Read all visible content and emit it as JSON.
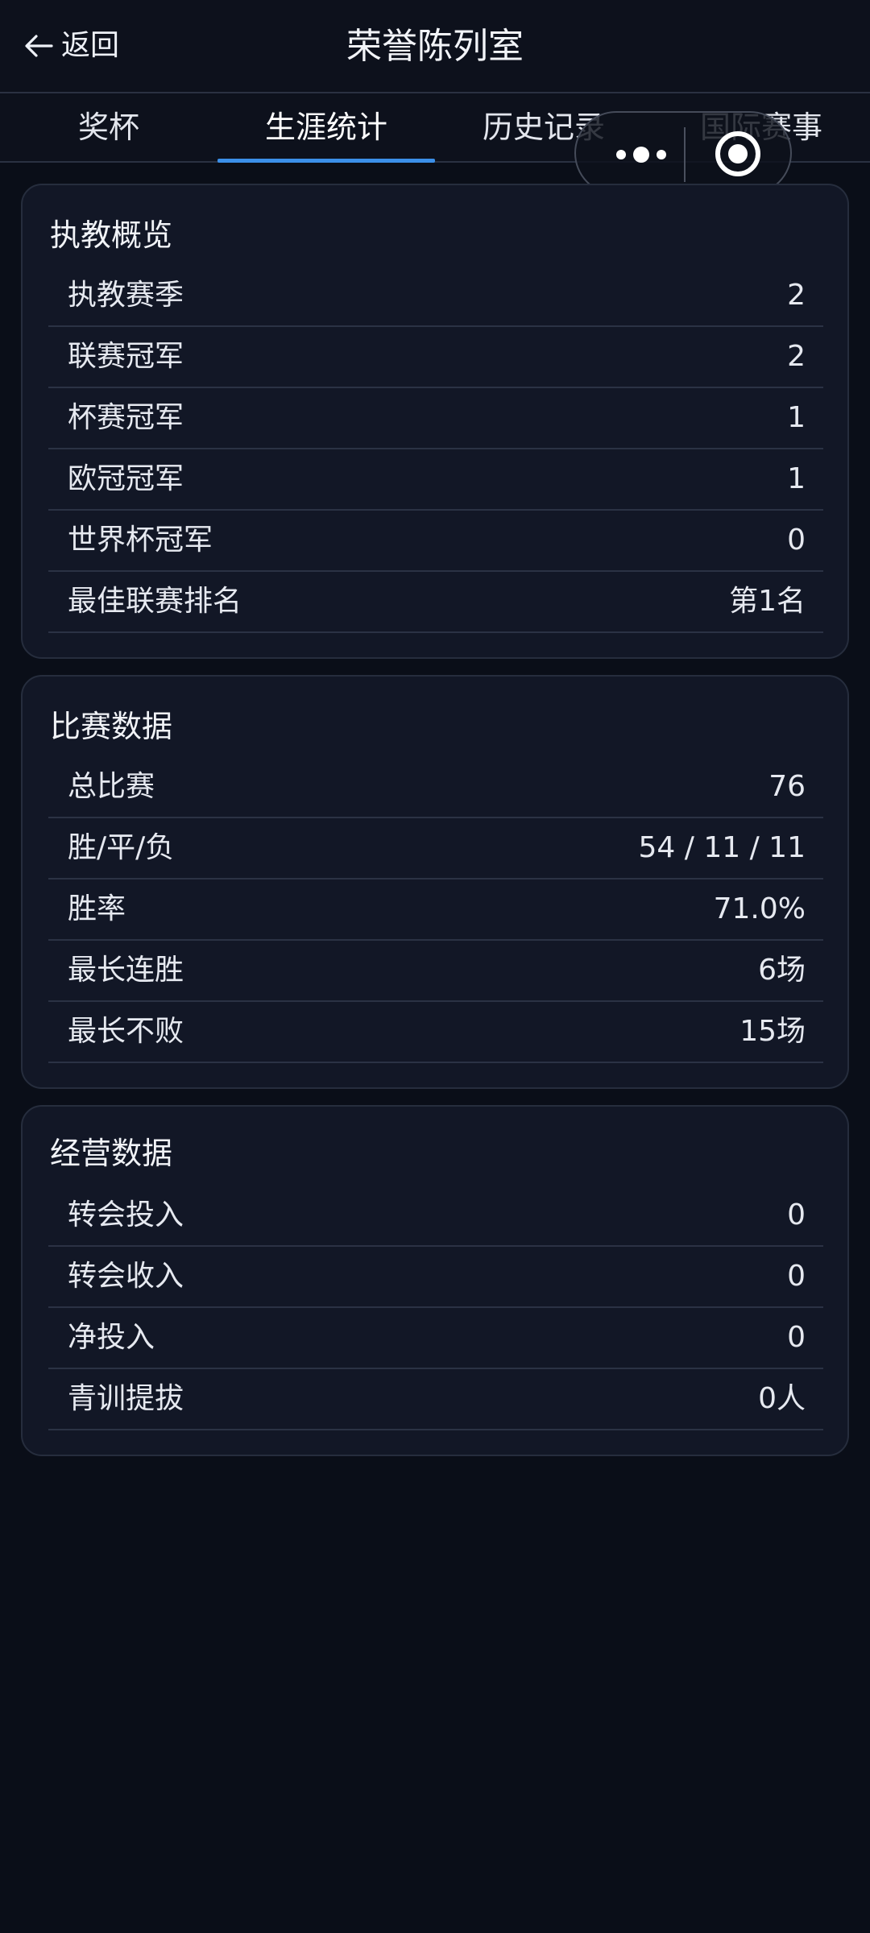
{
  "header": {
    "back_label": "返回",
    "title": "荣誉陈列室"
  },
  "tabs": [
    {
      "label": "奖杯",
      "active": false
    },
    {
      "label": "生涯统计",
      "active": true
    },
    {
      "label": "历史记录",
      "active": false
    },
    {
      "label": "国际赛事",
      "active": false
    }
  ],
  "capsule": {
    "more_icon": "more-dots-icon",
    "close_icon": "target-close-icon"
  },
  "sections": [
    {
      "title": "执教概览",
      "rows": [
        {
          "label": "执教赛季",
          "value": "2"
        },
        {
          "label": "联赛冠军",
          "value": "2"
        },
        {
          "label": "杯赛冠军",
          "value": "1"
        },
        {
          "label": "欧冠冠军",
          "value": "1"
        },
        {
          "label": "世界杯冠军",
          "value": "0"
        },
        {
          "label": "最佳联赛排名",
          "value": "第1名"
        }
      ]
    },
    {
      "title": "比赛数据",
      "rows": [
        {
          "label": "总比赛",
          "value": "76"
        },
        {
          "label": "胜/平/负",
          "value": "54 / 11 / 11"
        },
        {
          "label": "胜率",
          "value": "71.0%"
        },
        {
          "label": "最长连胜",
          "value": "6场"
        },
        {
          "label": "最长不败",
          "value": "15场"
        }
      ]
    },
    {
      "title": "经营数据",
      "rows": [
        {
          "label": "转会投入",
          "value": "0"
        },
        {
          "label": "转会收入",
          "value": "0"
        },
        {
          "label": "净投入",
          "value": "0"
        },
        {
          "label": "青训提拔",
          "value": "0人"
        }
      ]
    }
  ],
  "colors": {
    "background": "#0a0e18",
    "card": "#121726",
    "accent": "#3b8fe8"
  }
}
